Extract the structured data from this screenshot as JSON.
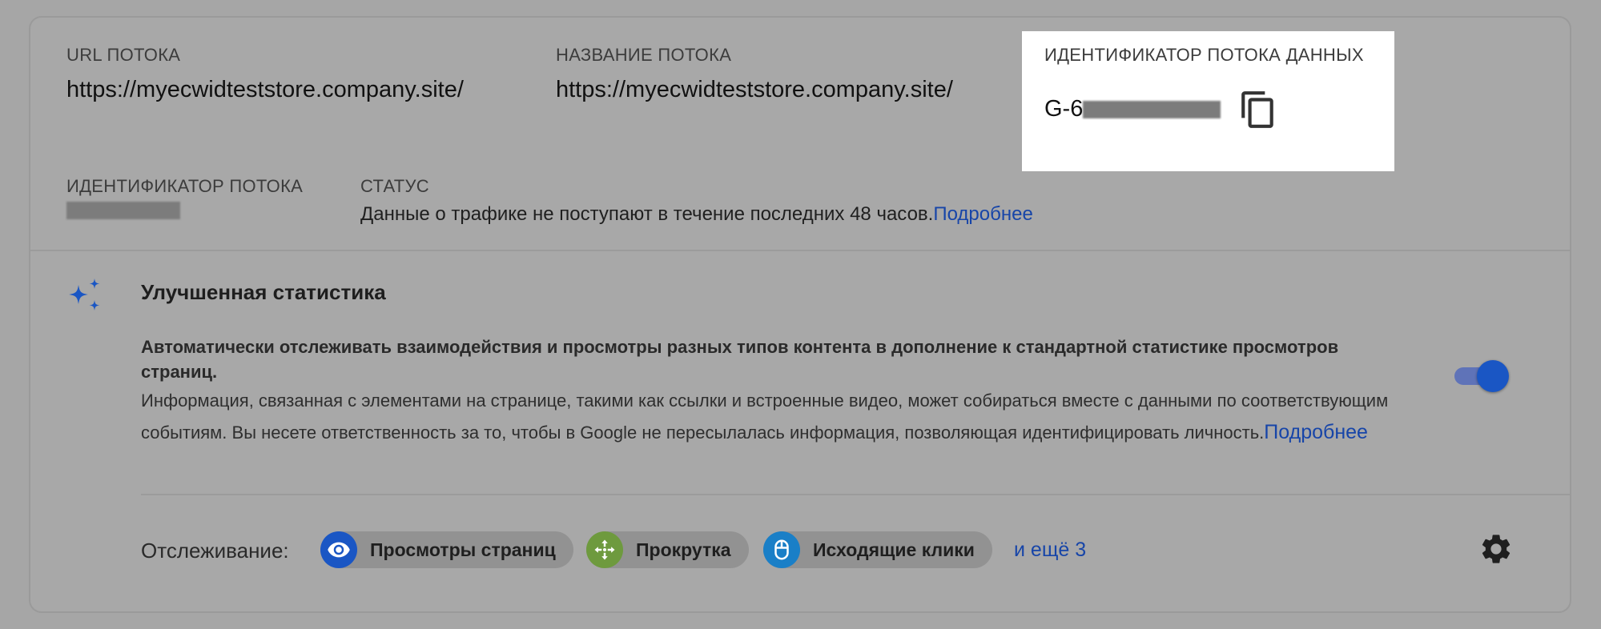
{
  "stream_url": {
    "label": "URL ПОТОКА",
    "value": "https://myecwidteststore.company.site/"
  },
  "stream_name": {
    "label": "НАЗВАНИЕ ПОТОКА",
    "value": "https://myecwidteststore.company.site/"
  },
  "measurement_id": {
    "label": "ИДЕНТИФИКАТОР ПОТОКА ДАННЫХ",
    "value_prefix": "G-6",
    "copy_icon": "copy-icon"
  },
  "stream_id": {
    "label": "ИДЕНТИФИКАТОР ПОТОКА"
  },
  "status": {
    "label": "СТАТУС",
    "text": "Данные о трафике не поступают в течение последних 48 часов.",
    "link": "Подробнее"
  },
  "enhanced": {
    "icon": "sparkle-icon",
    "title": "Улучшенная статистика",
    "description_bold": "Автоматически отслеживать взаимодействия и просмотры разных типов контента в дополнение к стандартной статистике просмотров страниц.",
    "description": "Информация, связанная с элементами на странице, такими как ссылки и встроенные видео, может собираться вместе с данными по соответствующим событиям. Вы несете ответственность за то, чтобы в Google не пересылалась информация, позволяющая идентифицировать личность.",
    "link": "Подробнее",
    "toggle_on": true
  },
  "tracking": {
    "label": "Отслеживание:",
    "chips": [
      {
        "label": "Просмотры страниц",
        "icon": "eye-icon",
        "color": "#1a56c4"
      },
      {
        "label": "Прокрутка",
        "icon": "scroll-arrows-icon",
        "color": "#6e9a3e"
      },
      {
        "label": "Исходящие клики",
        "icon": "mouse-icon",
        "color": "#1a7fc7"
      }
    ],
    "more": "и ещё 3",
    "settings_icon": "gear-icon"
  },
  "colors": {
    "accent": "#1a56c4",
    "link": "#1745a8",
    "highlight": "#ffffff"
  }
}
